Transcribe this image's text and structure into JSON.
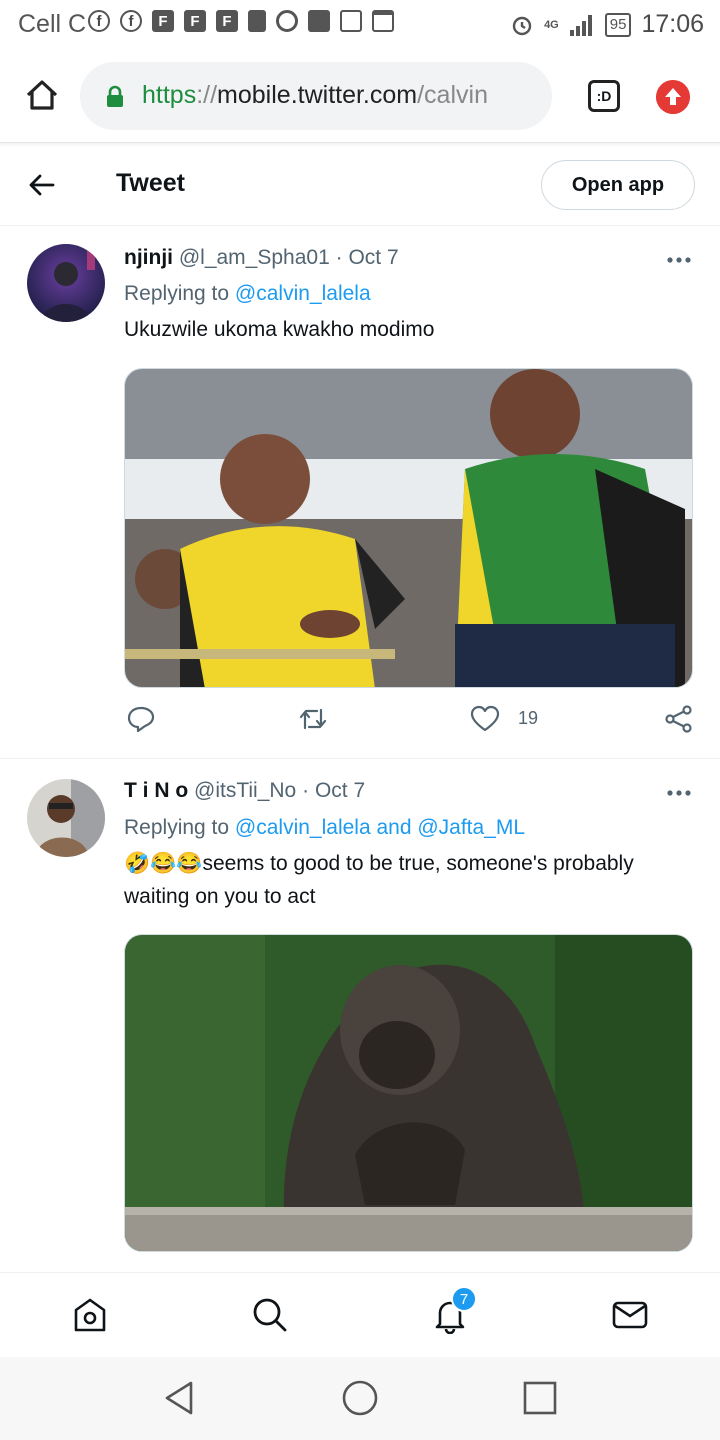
{
  "status_bar": {
    "carrier": "Cell C",
    "battery": "95",
    "time": "17:06",
    "network": "4G",
    "icons": [
      "facebook-icon",
      "facebook-icon",
      "flipboard-icon",
      "flipboard-icon",
      "flipboard-icon",
      "sd-card-icon",
      "hotspot-icon",
      "app-icon",
      "gallery-icon",
      "calendar-icon",
      "alarm-icon",
      "signal-icon",
      "battery-icon"
    ]
  },
  "browser": {
    "url_scheme": "https",
    "url_sep": "://",
    "url_host": "mobile.twitter.com",
    "url_path": "/calvin",
    "tabs_label": ":D"
  },
  "header": {
    "title": "Tweet",
    "open_app": "Open app"
  },
  "tweets": [
    {
      "name": "njinji",
      "handle": "@l_am_Spha01",
      "dot": "·",
      "date": "Oct 7",
      "replying_prefix": "Replying to ",
      "mentions": "@calvin_lalela",
      "text": "Ukuzwile ukoma kwakho modimo",
      "like_count": "19",
      "media_description": "photo"
    },
    {
      "name": "T i N o",
      "handle": "@itsTii_No",
      "dot": "·",
      "date": "Oct 7",
      "replying_prefix": "Replying to ",
      "mentions": "@calvin_lalela and @Jafta_ML",
      "text": "🤣😂😂seems to good to be true, someone's probably waiting on you to act",
      "media_description": "photo"
    }
  ],
  "bottom_nav": {
    "notifications_badge": "7",
    "items": [
      "home-icon",
      "search-icon",
      "notifications-icon",
      "messages-icon"
    ]
  },
  "colors": {
    "accent": "#1d9bf0",
    "secondary_text": "#536471",
    "url_scheme": "#1e8e3e"
  }
}
